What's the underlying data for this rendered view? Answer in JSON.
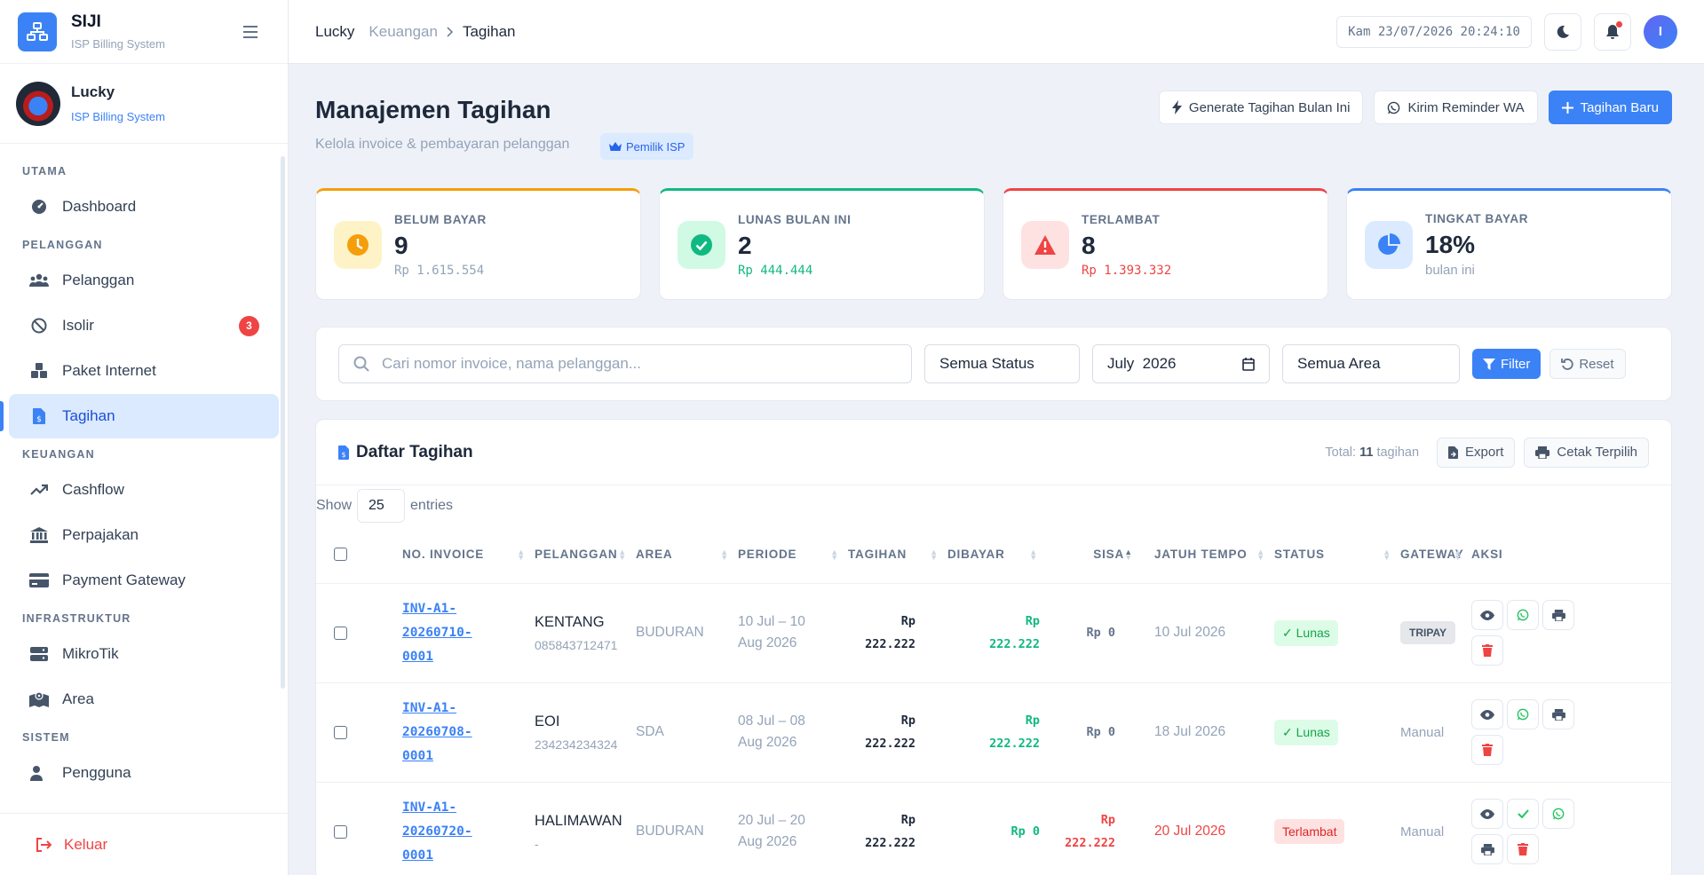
{
  "brand": {
    "title": "SIJI",
    "subtitle": "ISP Billing System"
  },
  "user": {
    "name": "Lucky",
    "role": "ISP Billing System"
  },
  "sidebar": {
    "sections": [
      {
        "label": "UTAMA"
      },
      {
        "label": "PELANGGAN"
      },
      {
        "label": "KEUANGAN"
      },
      {
        "label": "INFRASTRUKTUR"
      },
      {
        "label": "SISTEM"
      }
    ],
    "items": {
      "dashboard": "Dashboard",
      "pelanggan": "Pelanggan",
      "isolir": "Isolir",
      "isolir_badge": "3",
      "paket": "Paket Internet",
      "tagihan": "Tagihan",
      "cashflow": "Cashflow",
      "perpajakan": "Perpajakan",
      "payment_gateway": "Payment Gateway",
      "mikrotik": "MikroTik",
      "area": "Area",
      "pengguna": "Pengguna"
    },
    "logout": "Keluar"
  },
  "topbar": {
    "breadcrumb": [
      "Lucky",
      "Keuangan",
      "Tagihan"
    ],
    "clock": "Kam 23/07/2026 20:24:10",
    "avatar_initial": "I"
  },
  "page": {
    "title": "Manajemen Tagihan",
    "subtitle": "Kelola invoice & pembayaran pelanggan",
    "badge": "Pemilik ISP",
    "actions": {
      "generate": "Generate Tagihan Bulan Ini",
      "reminder": "Kirim Reminder WA",
      "new": "Tagihan Baru"
    }
  },
  "stats": [
    {
      "label": "BELUM BAYAR",
      "value": "9",
      "sub": "Rp 1.615.554",
      "color": "#f59e0b"
    },
    {
      "label": "LUNAS BULAN INI",
      "value": "2",
      "sub": "Rp 444.444",
      "color": "#10b981"
    },
    {
      "label": "TERLAMBAT",
      "value": "8",
      "sub": "Rp 1.393.332",
      "color": "#ef4444"
    },
    {
      "label": "TINGKAT BAYAR",
      "value": "18%",
      "sub": "bulan ini",
      "color": "#3b82f6"
    }
  ],
  "filters": {
    "search_placeholder": "Cari nomor invoice, nama pelanggan...",
    "status": "Semua Status",
    "month": "July  2026",
    "area": "Semua Area",
    "filter_btn": "Filter",
    "reset_btn": "Reset"
  },
  "table": {
    "title": "Daftar Tagihan",
    "total_prefix": "Total:",
    "total_count": "11",
    "total_suffix": "tagihan",
    "export": "Export",
    "print": "Cetak Terpilih",
    "show_label": "Show",
    "show_value": "25",
    "entries_label": "entries",
    "headers": [
      "NO. INVOICE",
      "PELANGGAN",
      "AREA",
      "PERIODE",
      "TAGIHAN",
      "DIBAYAR",
      "SISA",
      "JATUH TEMPO",
      "STATUS",
      "GATEWAY",
      "AKSI"
    ],
    "rows": [
      {
        "inv1": "INV-A1-",
        "inv2": "20260710-",
        "inv3": "0001",
        "name": "KENTANG",
        "phone": "085843712471",
        "area": "BUDURAN",
        "per1": "10 Jul – 10",
        "per2": "Aug 2026",
        "tag1": "Rp",
        "tag2": "222.222",
        "bay1": "Rp",
        "bay2": "222.222",
        "sisa": "Rp 0",
        "due": "10 Jul 2026",
        "status": "✓ Lunas",
        "gateway": "TRIPAY"
      },
      {
        "inv1": "INV-A1-",
        "inv2": "20260708-",
        "inv3": "0001",
        "name": "EOI",
        "phone": "234234234324",
        "area": "SDA",
        "per1": "08 Jul – 08",
        "per2": "Aug 2026",
        "tag1": "Rp",
        "tag2": "222.222",
        "bay1": "Rp",
        "bay2": "222.222",
        "sisa": "Rp 0",
        "due": "18 Jul 2026",
        "status": "✓ Lunas",
        "gateway": "Manual"
      },
      {
        "inv1": "INV-A1-",
        "inv2": "20260720-",
        "inv3": "0001",
        "name": "HALIMAWAN",
        "phone": "-",
        "area": "BUDURAN",
        "per1": "20 Jul – 20",
        "per2": "Aug 2026",
        "tag1": "Rp",
        "tag2": "222.222",
        "bay1": "Rp 0",
        "bay2": "",
        "sisa1": "Rp",
        "sisa2": "222.222",
        "due": "20 Jul 2026",
        "status": "Terlambat",
        "gateway": "Manual"
      }
    ]
  }
}
